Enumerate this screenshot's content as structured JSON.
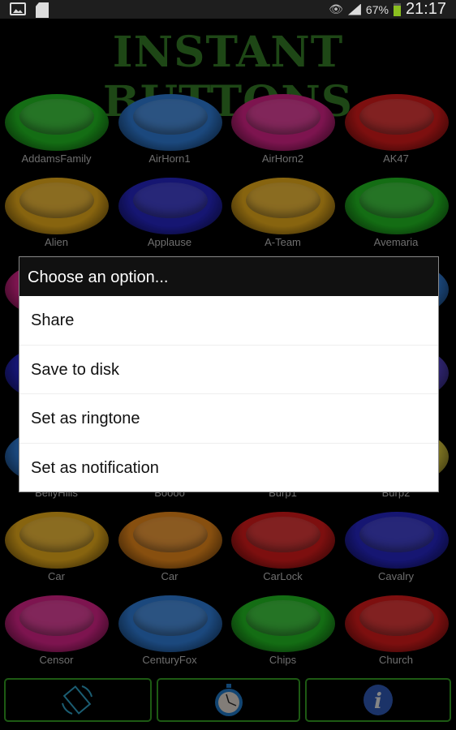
{
  "status": {
    "battery": "67%",
    "time": "21:17"
  },
  "title": "INSTANT BUTTONS",
  "buttons": [
    {
      "label": "AddamsFamily",
      "color": "#1fa81f"
    },
    {
      "label": "AirHorn1",
      "color": "#2a6fc0"
    },
    {
      "label": "AirHorn2",
      "color": "#c0207a"
    },
    {
      "label": "AK47",
      "color": "#c01818"
    },
    {
      "label": "Alien",
      "color": "#d09a18"
    },
    {
      "label": "Applause",
      "color": "#2222b0"
    },
    {
      "label": "A-Team",
      "color": "#d09a18"
    },
    {
      "label": "Avemaria",
      "color": "#1fa81f"
    },
    {
      "label": "",
      "color": "#c0207a"
    },
    {
      "label": "",
      "color": "#c01818"
    },
    {
      "label": "",
      "color": "#c07018"
    },
    {
      "label": "",
      "color": "#2a6fc0"
    },
    {
      "label": "",
      "color": "#2222b0"
    },
    {
      "label": "",
      "color": "#c01818"
    },
    {
      "label": "",
      "color": "#1fa81f"
    },
    {
      "label": "",
      "color": "#4a3ab0"
    },
    {
      "label": "BellyHills",
      "color": "#2a6fc0"
    },
    {
      "label": "Boooo",
      "color": "#c07018"
    },
    {
      "label": "Burp1",
      "color": "#c01818"
    },
    {
      "label": "Burp2",
      "color": "#c8b838"
    },
    {
      "label": "Car",
      "color": "#d09a18"
    },
    {
      "label": "Car",
      "color": "#d07a18"
    },
    {
      "label": "CarLock",
      "color": "#c01818"
    },
    {
      "label": "Cavalry",
      "color": "#2222b0"
    },
    {
      "label": "Censor",
      "color": "#c0207a"
    },
    {
      "label": "CenturyFox",
      "color": "#2a6fc0"
    },
    {
      "label": "Chips",
      "color": "#1fa81f"
    },
    {
      "label": "Church",
      "color": "#c01818"
    }
  ],
  "bottom_bar": [
    {
      "icon": "rotate-icon"
    },
    {
      "icon": "stopwatch-icon"
    },
    {
      "icon": "info-icon"
    }
  ],
  "dialog": {
    "title": "Choose an option...",
    "options": [
      "Share",
      "Save to disk",
      "Set as ringtone",
      "Set as notification"
    ]
  }
}
